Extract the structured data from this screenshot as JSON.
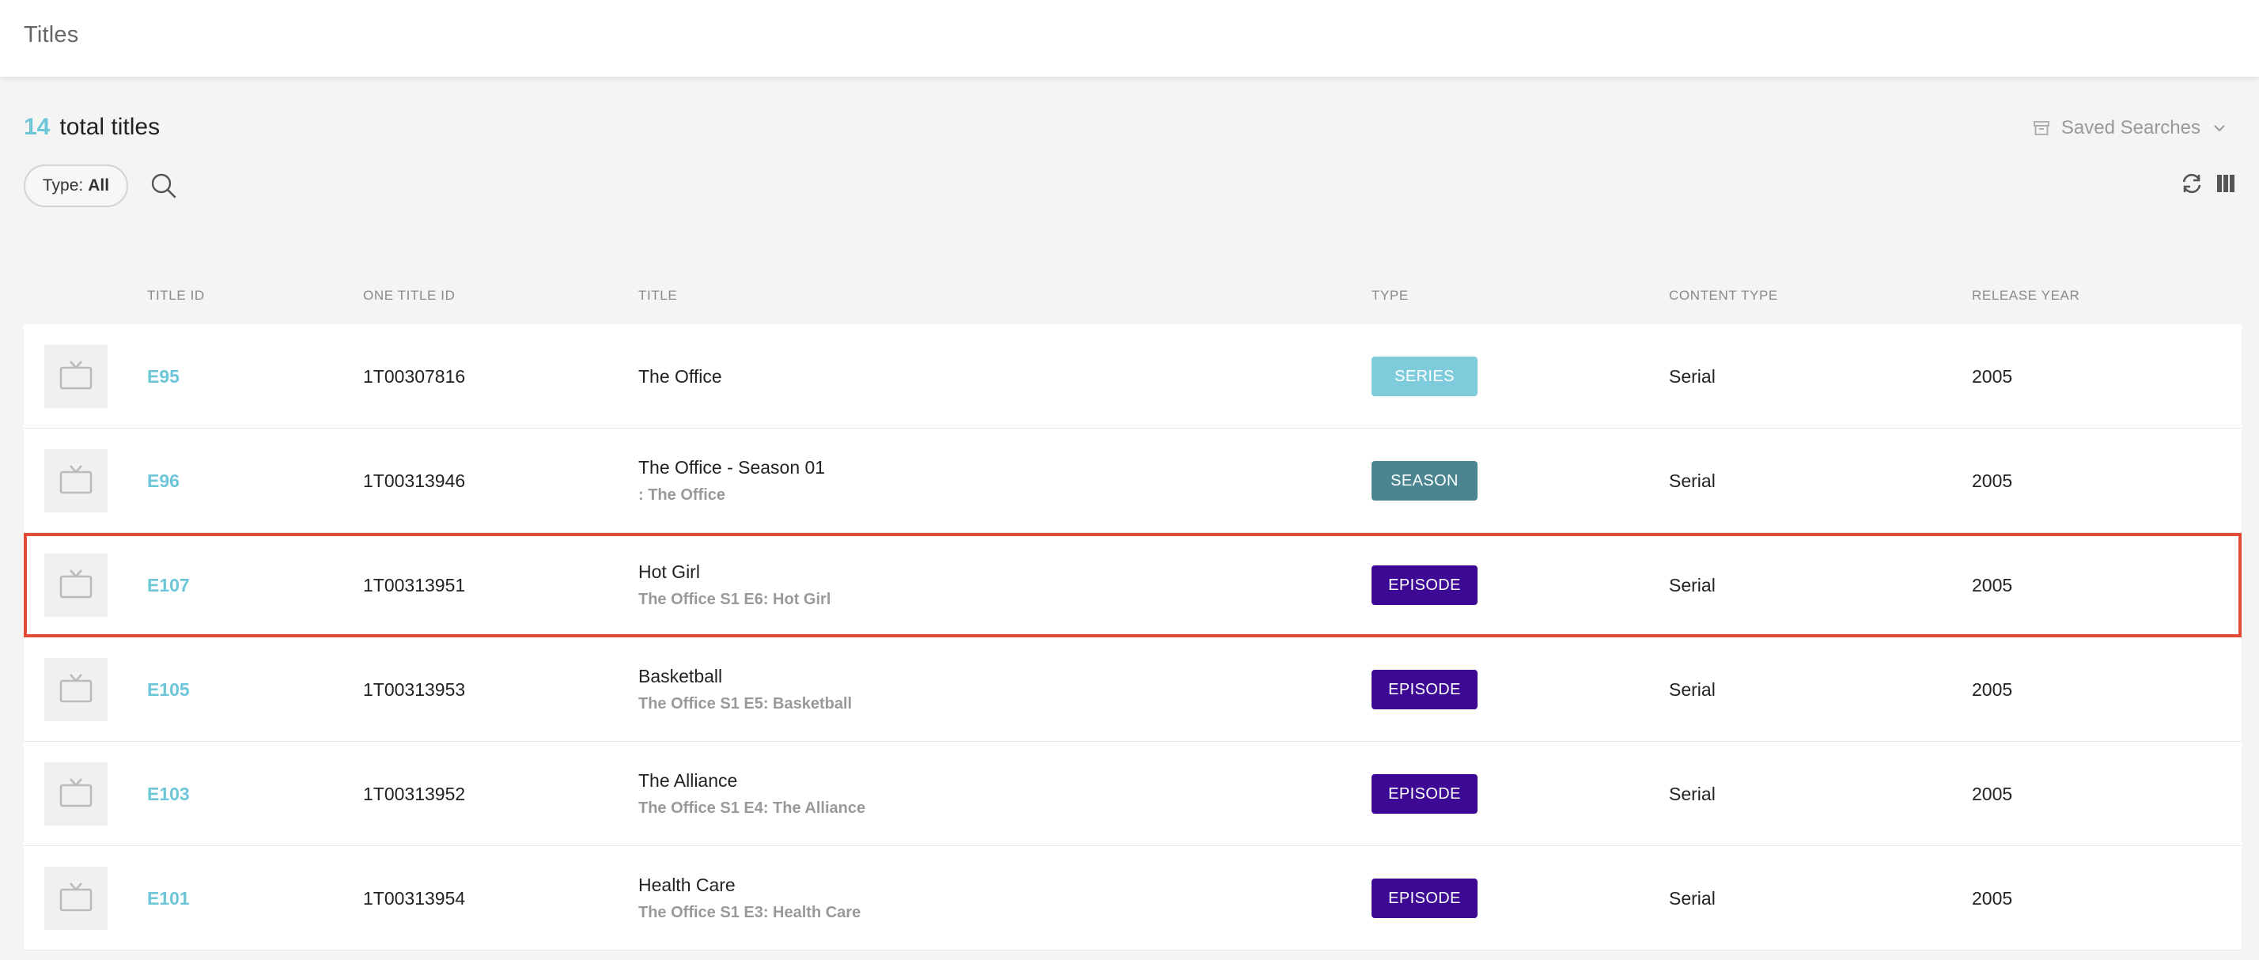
{
  "header": {
    "title": "Titles"
  },
  "summary": {
    "count": "14",
    "label": "total titles"
  },
  "saved_searches": {
    "label": "Saved Searches"
  },
  "filter": {
    "label": "Type:",
    "value": "All"
  },
  "icons": {
    "search": "search-icon",
    "refresh": "refresh-icon",
    "columns": "columns-icon",
    "archive": "archive-icon",
    "chevron": "chevron-down-icon",
    "tv": "tv-icon"
  },
  "colors": {
    "accent": "#6cc6d8",
    "series": "#7ecbdc",
    "season": "#4a8590",
    "episode": "#3d0893",
    "highlight": "#e04a36"
  },
  "table": {
    "columns": [
      "TITLE ID",
      "ONE TITLE ID",
      "TITLE",
      "TYPE",
      "CONTENT TYPE",
      "RELEASE YEAR"
    ],
    "rows": [
      {
        "title_id": "E95",
        "one_title_id": "1T00307816",
        "title": "The Office",
        "subtitle": "",
        "type": "SERIES",
        "content_type": "Serial",
        "release_year": "2005"
      },
      {
        "title_id": "E96",
        "one_title_id": "1T00313946",
        "title": "The Office - Season 01",
        "subtitle": ": The Office",
        "type": "SEASON",
        "content_type": "Serial",
        "release_year": "2005"
      },
      {
        "title_id": "E107",
        "one_title_id": "1T00313951",
        "title": "Hot Girl",
        "subtitle": "The Office S1 E6: Hot Girl",
        "type": "EPISODE",
        "content_type": "Serial",
        "release_year": "2005"
      },
      {
        "title_id": "E105",
        "one_title_id": "1T00313953",
        "title": "Basketball",
        "subtitle": "The Office S1 E5: Basketball",
        "type": "EPISODE",
        "content_type": "Serial",
        "release_year": "2005"
      },
      {
        "title_id": "E103",
        "one_title_id": "1T00313952",
        "title": "The Alliance",
        "subtitle": "The Office S1 E4: The Alliance",
        "type": "EPISODE",
        "content_type": "Serial",
        "release_year": "2005"
      },
      {
        "title_id": "E101",
        "one_title_id": "1T00313954",
        "title": "Health Care",
        "subtitle": "The Office S1 E3: Health Care",
        "type": "EPISODE",
        "content_type": "Serial",
        "release_year": "2005"
      }
    ]
  }
}
